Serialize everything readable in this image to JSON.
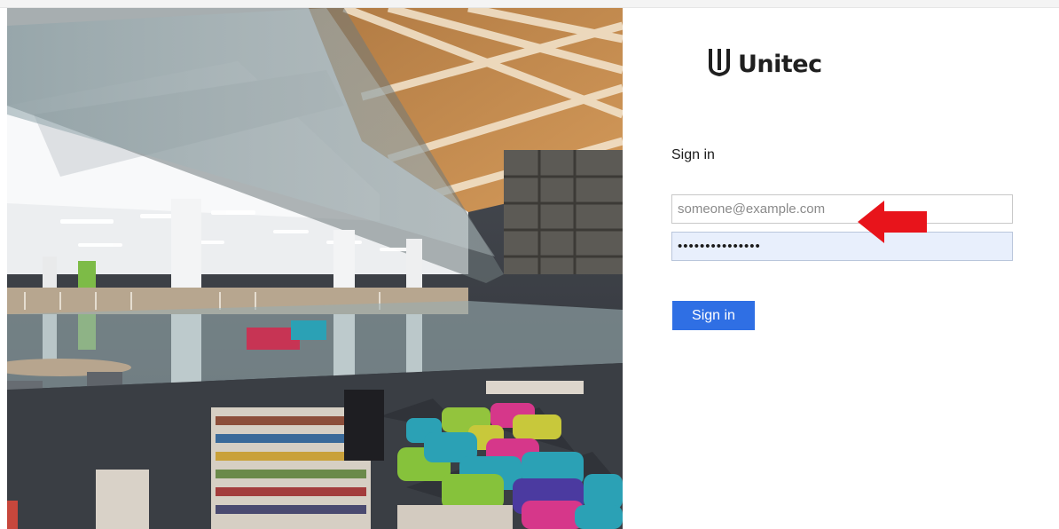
{
  "brand": {
    "name": "Unitec",
    "icon": "unitec-logo-icon",
    "accent": "#2f6fe4"
  },
  "form": {
    "title": "Sign in",
    "email_placeholder": "someone@example.com",
    "email_value": "",
    "password_value": "•••••••••••••••",
    "submit_label": "Sign in"
  },
  "annotation": {
    "icon": "red-arrow-left-icon",
    "color": "#e8141b"
  },
  "hero": {
    "icon": "library-interior-photo"
  }
}
